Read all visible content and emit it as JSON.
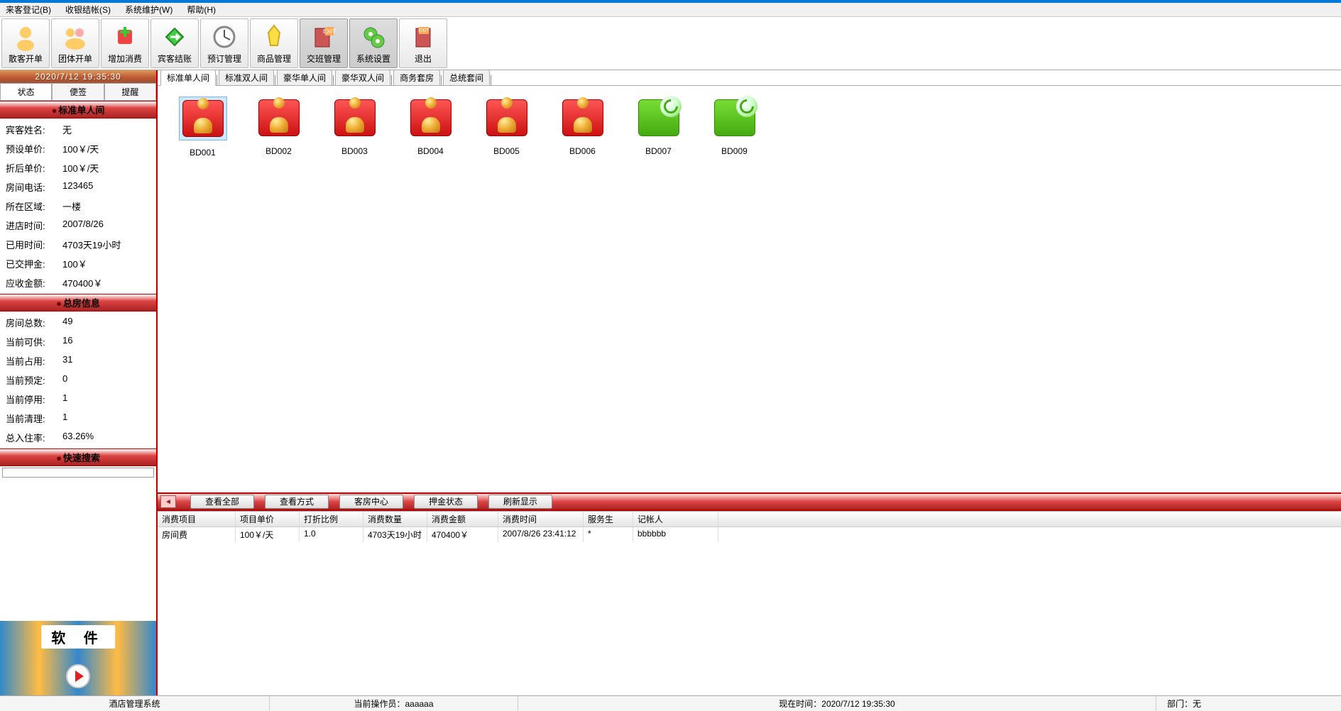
{
  "menu": {
    "items": [
      "来客登记(B)",
      "收银结帐(S)",
      "系统维护(W)",
      "帮助(H)"
    ]
  },
  "toolbar": [
    {
      "label": "散客开单",
      "icon": "single-guest"
    },
    {
      "label": "团体开单",
      "icon": "group-guest"
    },
    {
      "label": "增加消费",
      "icon": "add-consumption"
    },
    {
      "label": "宾客结账",
      "icon": "checkout"
    },
    {
      "label": "预订管理",
      "icon": "reservation"
    },
    {
      "label": "商品管理",
      "icon": "goods"
    },
    {
      "label": "交班管理",
      "icon": "shift"
    },
    {
      "label": "系统设置",
      "icon": "settings"
    },
    {
      "label": "退出",
      "icon": "exit"
    }
  ],
  "sidebar": {
    "time": "2020/7/12 19:35:30",
    "tabs": [
      "状态",
      "便签",
      "提醒"
    ],
    "room_type_header": "标准单人间",
    "status_rows": [
      {
        "label": "宾客姓名:",
        "value": "无"
      },
      {
        "label": "预设单价:",
        "value": "100￥/天"
      },
      {
        "label": "折后单价:",
        "value": "100￥/天"
      },
      {
        "label": "房间电话:",
        "value": "123465"
      },
      {
        "label": "所在区域:",
        "value": "一楼"
      },
      {
        "label": "进店时间:",
        "value": "2007/8/26"
      },
      {
        "label": "已用时间:",
        "value": "4703天19小时"
      },
      {
        "label": "已交押金:",
        "value": "100￥"
      },
      {
        "label": "应收金额:",
        "value": "470400￥"
      }
    ],
    "summary_header": "总房信息",
    "summary_rows": [
      {
        "label": "房间总数:",
        "value": "49"
      },
      {
        "label": "当前可供:",
        "value": "16"
      },
      {
        "label": "当前占用:",
        "value": "31"
      },
      {
        "label": "当前预定:",
        "value": "0"
      },
      {
        "label": "当前停用:",
        "value": "1"
      },
      {
        "label": "当前清理:",
        "value": "1"
      },
      {
        "label": "总入住率:",
        "value": "63.26%"
      }
    ],
    "search_header": "快速搜索",
    "promo_label": "软 件"
  },
  "room_tabs": [
    "标准单人间",
    "标准双人间",
    "豪华单人间",
    "豪华双人间",
    "商务套房",
    "总统套间"
  ],
  "rooms": [
    {
      "code": "BD001",
      "state": "occupied",
      "sel": true
    },
    {
      "code": "BD002",
      "state": "occupied"
    },
    {
      "code": "BD003",
      "state": "occupied"
    },
    {
      "code": "BD004",
      "state": "occupied"
    },
    {
      "code": "BD005",
      "state": "occupied"
    },
    {
      "code": "BD006",
      "state": "occupied"
    },
    {
      "code": "BD007",
      "state": "vacant"
    },
    {
      "code": "BD009",
      "state": "vacant"
    }
  ],
  "action_buttons": [
    "查看全部",
    "查看方式",
    "客房中心",
    "押金状态",
    "刷新显示"
  ],
  "table": {
    "headers": [
      "消费项目",
      "项目单价",
      "打折比例",
      "消费数量",
      "消费金额",
      "消费时间",
      "服务生",
      "记帐人"
    ],
    "rows": [
      [
        "房间费",
        "100￥/天",
        "1.0",
        "4703天19小时",
        "470400￥",
        "2007/8/26 23:41:12",
        "*",
        "bbbbbb"
      ]
    ]
  },
  "statusbar": {
    "app": "酒店管理系统",
    "operator": "当前操作员：aaaaaa",
    "now": "现在时间：2020/7/12 19:35:30",
    "dept": "部门：无"
  }
}
